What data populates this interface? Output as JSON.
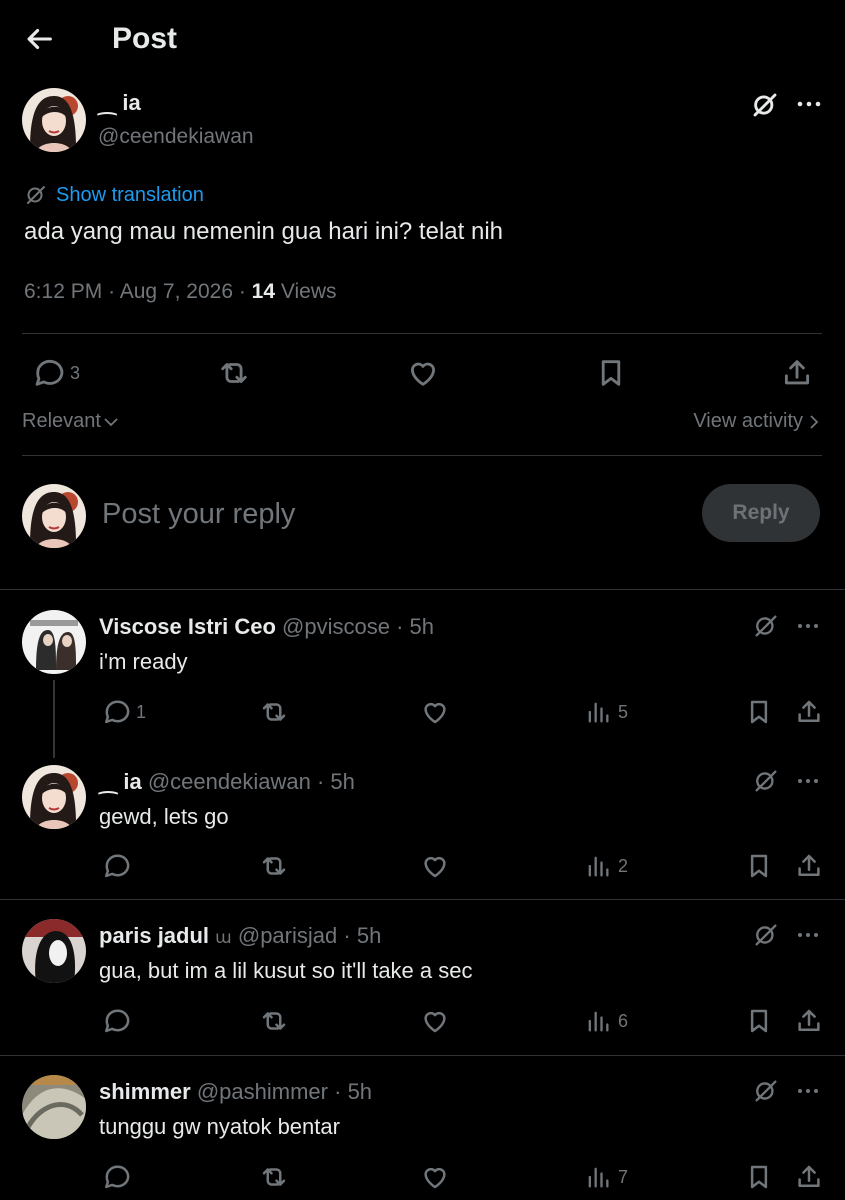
{
  "header": {
    "title": "Post",
    "back_icon": "arrow-left-icon"
  },
  "main_post": {
    "display_name": "⁔ ia",
    "handle": "@ceendekiawan",
    "translation_label": "Show translation",
    "text": "ada yang mau nemenin gua hari ini? telat nih",
    "time": "6:12 PM",
    "date": "Aug 7, 2026",
    "views_count": "14",
    "views_label": "Views",
    "replies_count": "3"
  },
  "sort": {
    "label": "Relevant",
    "activity_label": "View activity"
  },
  "composer": {
    "placeholder": "Post your reply",
    "button_label": "Reply"
  },
  "replies": [
    {
      "name": "Viscose Istri Ceo",
      "handle": "@pviscose",
      "time": "5h",
      "text": "i'm ready",
      "reply_count": "1",
      "views": "5"
    },
    {
      "name": "⁔ ia",
      "handle": "@ceendekiawan",
      "time": "5h",
      "text": "gewd, lets go",
      "reply_count": "",
      "views": "2"
    },
    {
      "name": "paris jadul",
      "badge": "ա",
      "handle": "@parisjad",
      "time": "5h",
      "text": "gua, but im a lil kusut so it'll take a sec",
      "reply_count": "",
      "views": "6"
    },
    {
      "name": "shimmer",
      "handle": "@pashimmer",
      "time": "5h",
      "text": "tunggu gw nyatok bentar",
      "reply_count": "",
      "views": "7"
    }
  ],
  "colors": {
    "background": "#000000",
    "text": "#e7e9ea",
    "muted": "#71767b",
    "link": "#1d9bf0",
    "divider": "#2f3336"
  }
}
